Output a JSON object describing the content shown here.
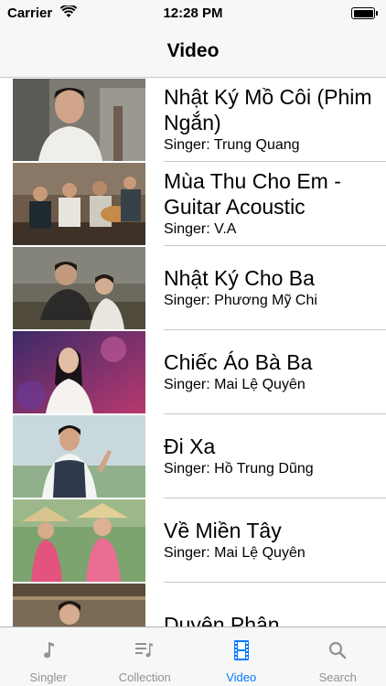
{
  "status_bar": {
    "carrier": "Carrier",
    "time": "12:28 PM"
  },
  "nav": {
    "title": "Video"
  },
  "videos": [
    {
      "title": "Nhật Ký Mồ Côi (Phim Ngắn)",
      "singer": "Singer: Trung Quang"
    },
    {
      "title": "Mùa Thu Cho Em - Guitar Acoustic",
      "singer": "Singer: V.A"
    },
    {
      "title": "Nhật Ký Cho Ba",
      "singer": "Singer: Phương Mỹ Chi"
    },
    {
      "title": "Chiếc Áo Bà Ba",
      "singer": "Singer: Mai Lệ Quyên"
    },
    {
      "title": "Đi Xa",
      "singer": "Singer: Hồ Trung Dũng"
    },
    {
      "title": "Về Miền Tây",
      "singer": "Singer: Mai Lệ Quyên"
    },
    {
      "title": "Duyên Phận",
      "singer": ""
    }
  ],
  "tabs": [
    {
      "label": "Singler",
      "icon": "music-note-icon"
    },
    {
      "label": "Collection",
      "icon": "playlist-icon"
    },
    {
      "label": "Video",
      "icon": "film-icon",
      "active": true
    },
    {
      "label": "Search",
      "icon": "search-icon"
    }
  ],
  "colors": {
    "accent": "#007aff",
    "inactive": "#929292",
    "separator": "#c8c7cc"
  }
}
